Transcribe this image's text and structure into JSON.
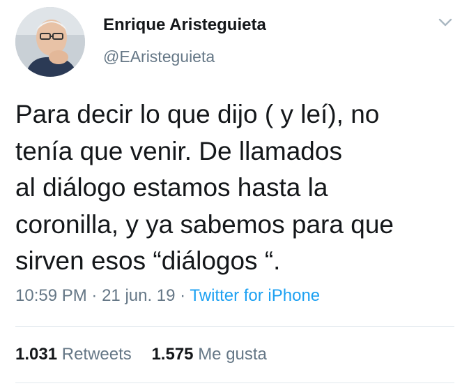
{
  "user": {
    "display_name": "Enrique Aristeguieta",
    "handle": "@EAristeguieta",
    "avatar_icon": "profile-photo"
  },
  "tweet": {
    "lines": [
      "Para decir lo que dijo ( y leí), no",
      "tenía que venir. De llamados",
      "al diálogo estamos hasta la",
      "coronilla, y ya sabemos para que",
      "sirven esos “diálogos “."
    ],
    "time": "10:59 PM",
    "date": "21 jun. 19",
    "separator": "·",
    "source": "Twitter for iPhone"
  },
  "stats": {
    "retweets_count": "1.031",
    "retweets_label": "Retweets",
    "likes_count": "1.575",
    "likes_label": "Me gusta"
  },
  "icons": {
    "menu": "chevron-down-icon"
  },
  "colors": {
    "text": "#14171a",
    "secondary": "#657786",
    "link": "#1da1f2",
    "divider": "#e1e8ed"
  }
}
